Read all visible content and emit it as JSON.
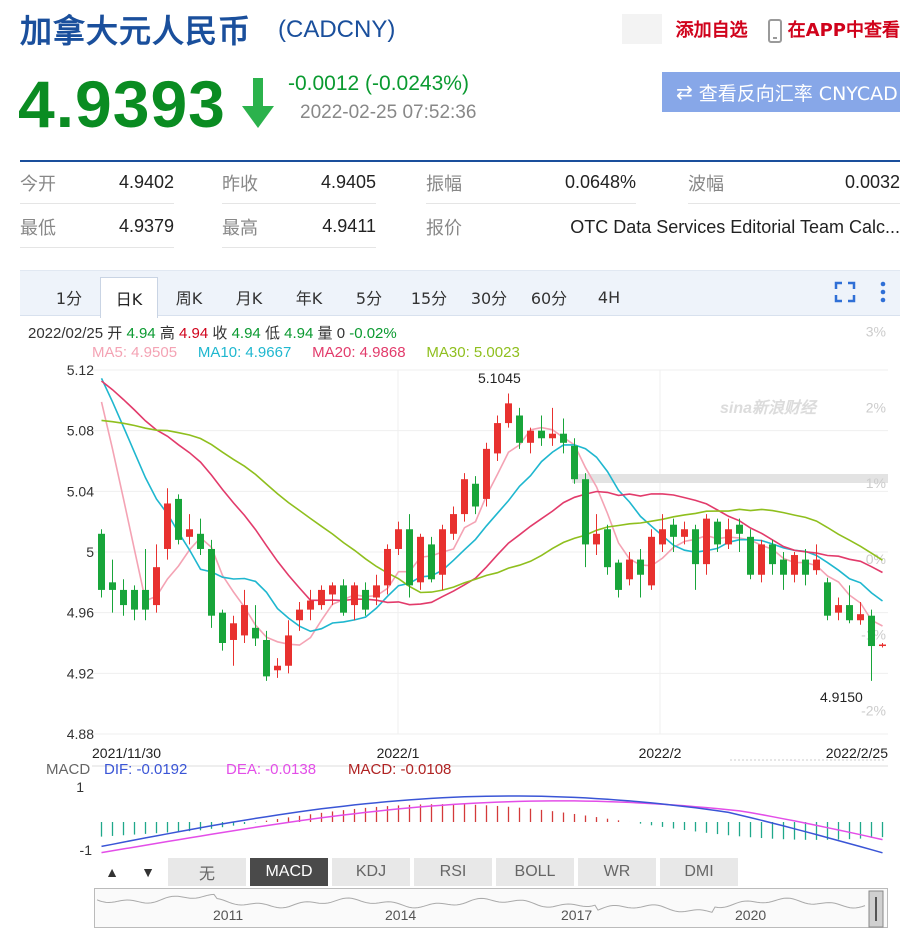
{
  "header": {
    "title": "加拿大元人民币",
    "code": "(CADCNY)",
    "add_watchlist": "添加自选",
    "view_in_app": "在APP中查看"
  },
  "quote": {
    "price": "4.9393",
    "change": "-0.0012 (-0.0243%)",
    "time": "2022-02-25 07:52:36",
    "reverse_button": "查看反向汇率 CNYCAD"
  },
  "stats": [
    [
      {
        "label": "今开",
        "value": "4.9402"
      },
      {
        "label": "昨收",
        "value": "4.9405"
      },
      {
        "label": "振幅",
        "value": "0.0648%"
      },
      {
        "label": "波幅",
        "value": "0.0032"
      }
    ],
    [
      {
        "label": "最低",
        "value": "4.9379"
      },
      {
        "label": "最高",
        "value": "4.9411"
      },
      {
        "label": "报价",
        "value": "OTC Data Services Editorial Team Calc..."
      }
    ]
  ],
  "tabs": [
    "1分",
    "日K",
    "周K",
    "月K",
    "年K",
    "5分",
    "15分",
    "30分",
    "60分",
    "4H"
  ],
  "active_tab": 1,
  "info": {
    "date": "2022/02/25",
    "open_label": "开",
    "open": "4.94",
    "high_label": "高",
    "high": "4.94",
    "close_label": "收",
    "close": "4.94",
    "low_label": "低",
    "low": "4.94",
    "vol_label": "量",
    "vol": "0",
    "pct": "-0.02%"
  },
  "ma": [
    {
      "label": "MA5: 4.9505",
      "color": "#f4a3b4"
    },
    {
      "label": "MA10: 4.9667",
      "color": "#1fb7cf"
    },
    {
      "label": "MA20: 4.9868",
      "color": "#e23b6b"
    },
    {
      "label": "MA30: 5.0023",
      "color": "#8fbf1e"
    }
  ],
  "macd_legend": {
    "title": "MACD",
    "dif": "DIF: -0.0192",
    "dea": "DEA: -0.0138",
    "macd": "MACD: -0.0108"
  },
  "bottom_tabs": [
    "无",
    "MACD",
    "KDJ",
    "RSI",
    "BOLL",
    "WR",
    "DMI"
  ],
  "bottom_active": 1,
  "navigator_years": [
    "2011",
    "2014",
    "2017",
    "2020"
  ],
  "colors": {
    "up": "#e8312f",
    "down": "#18a53a",
    "brand": "#1a4f9c"
  },
  "chart_data": {
    "type": "candlestick",
    "watermark": "sina新浪财经",
    "y_ticks": [
      "5.12",
      "5.08",
      "5.04",
      "5",
      "4.96",
      "4.92",
      "4.88"
    ],
    "y_right_ticks": [
      "3%",
      "2%",
      "1%",
      "0%",
      "-1%",
      "-2%"
    ],
    "ylim": [
      4.88,
      5.12
    ],
    "x_labels": [
      "2021/11/30",
      "2022/1",
      "2022/2",
      "2022/2/25"
    ],
    "annotations": [
      {
        "text": "5.1045",
        "value": 5.1045,
        "type": "max"
      },
      {
        "text": "4.9150",
        "value": 4.915,
        "type": "min"
      }
    ],
    "candles": [
      [
        5.012,
        4.975,
        5.015,
        4.97
      ],
      [
        4.98,
        4.975,
        4.995,
        4.96
      ],
      [
        4.975,
        4.965,
        4.982,
        4.958
      ],
      [
        4.975,
        4.962,
        4.978,
        4.955
      ],
      [
        4.975,
        4.962,
        5.002,
        4.955
      ],
      [
        4.965,
        4.99,
        5.005,
        4.96
      ],
      [
        5.002,
        5.032,
        5.042,
        4.995
      ],
      [
        5.035,
        5.008,
        5.038,
        5.005
      ],
      [
        5.01,
        5.015,
        5.025,
        5.005
      ],
      [
        5.012,
        5.002,
        5.022,
        4.998
      ],
      [
        5.002,
        4.958,
        5.008,
        4.95
      ],
      [
        4.96,
        4.94,
        4.962,
        4.935
      ],
      [
        4.942,
        4.953,
        4.958,
        4.925
      ],
      [
        4.945,
        4.965,
        4.975,
        4.94
      ],
      [
        4.95,
        4.943,
        4.965,
        4.938
      ],
      [
        4.942,
        4.918,
        4.948,
        4.915
      ],
      [
        4.922,
        4.925,
        4.93,
        4.917
      ],
      [
        4.925,
        4.945,
        4.955,
        4.92
      ],
      [
        4.955,
        4.962,
        4.967,
        4.948
      ],
      [
        4.962,
        4.968,
        4.975,
        4.955
      ],
      [
        4.965,
        4.975,
        4.978,
        4.962
      ],
      [
        4.972,
        4.978,
        4.98,
        4.965
      ],
      [
        4.978,
        4.96,
        4.982,
        4.958
      ],
      [
        4.965,
        4.978,
        4.98,
        4.955
      ],
      [
        4.975,
        4.962,
        4.98,
        4.958
      ],
      [
        4.97,
        4.978,
        4.985,
        4.965
      ],
      [
        4.978,
        5.002,
        5.005,
        4.972
      ],
      [
        5.002,
        5.015,
        5.02,
        4.998
      ],
      [
        5.015,
        4.978,
        5.025,
        4.97
      ],
      [
        4.98,
        5.01,
        5.012,
        4.975
      ],
      [
        5.005,
        4.982,
        5.01,
        4.98
      ],
      [
        4.985,
        5.015,
        5.018,
        4.975
      ],
      [
        5.012,
        5.025,
        5.03,
        5.008
      ],
      [
        5.025,
        5.048,
        5.052,
        5.02
      ],
      [
        5.045,
        5.03,
        5.05,
        5.025
      ],
      [
        5.035,
        5.068,
        5.072,
        5.03
      ],
      [
        5.065,
        5.085,
        5.09,
        5.06
      ],
      [
        5.085,
        5.098,
        5.1045,
        5.082
      ],
      [
        5.09,
        5.072,
        5.095,
        5.068
      ],
      [
        5.072,
        5.08,
        5.082,
        5.065
      ],
      [
        5.08,
        5.075,
        5.09,
        5.07
      ],
      [
        5.075,
        5.078,
        5.095,
        5.07
      ],
      [
        5.078,
        5.072,
        5.088,
        5.065
      ],
      [
        5.07,
        5.048,
        5.075,
        5.045
      ],
      [
        5.048,
        5.005,
        5.052,
        4.99
      ],
      [
        5.005,
        5.012,
        5.025,
        4.998
      ],
      [
        5.015,
        4.99,
        5.018,
        4.985
      ],
      [
        4.993,
        4.975,
        4.995,
        4.97
      ],
      [
        4.982,
        4.995,
        5.0,
        4.978
      ],
      [
        4.995,
        4.985,
        5.002,
        4.97
      ],
      [
        4.978,
        5.01,
        5.015,
        4.975
      ],
      [
        5.005,
        5.015,
        5.025,
        5.0
      ],
      [
        5.018,
        5.01,
        5.022,
        5.0
      ],
      [
        5.01,
        5.015,
        5.02,
        5.005
      ],
      [
        5.015,
        4.992,
        5.018,
        4.975
      ],
      [
        4.992,
        5.022,
        5.025,
        4.985
      ],
      [
        5.02,
        5.005,
        5.022,
        5.0
      ],
      [
        5.005,
        5.015,
        5.022,
        5.002
      ],
      [
        5.018,
        5.012,
        5.022,
        5.0
      ],
      [
        5.01,
        4.985,
        5.015,
        4.982
      ],
      [
        4.985,
        5.005,
        5.008,
        4.98
      ],
      [
        5.005,
        4.992,
        5.008,
        4.985
      ],
      [
        4.995,
        4.985,
        5.0,
        4.975
      ],
      [
        4.985,
        4.998,
        5.0,
        4.98
      ],
      [
        4.995,
        4.985,
        5.002,
        4.978
      ],
      [
        4.988,
        4.995,
        5.005,
        4.985
      ],
      [
        4.98,
        4.958,
        4.983,
        4.955
      ],
      [
        4.96,
        4.965,
        4.97,
        4.955
      ],
      [
        4.965,
        4.955,
        4.978,
        4.953
      ],
      [
        4.955,
        4.959,
        4.967,
        4.952
      ],
      [
        4.958,
        4.938,
        4.962,
        4.915
      ],
      [
        4.938,
        4.939,
        4.94,
        4.937
      ]
    ],
    "macd_ylim": [
      -1.2,
      1.2
    ],
    "macd_ticks": [
      "1",
      "-1"
    ]
  }
}
